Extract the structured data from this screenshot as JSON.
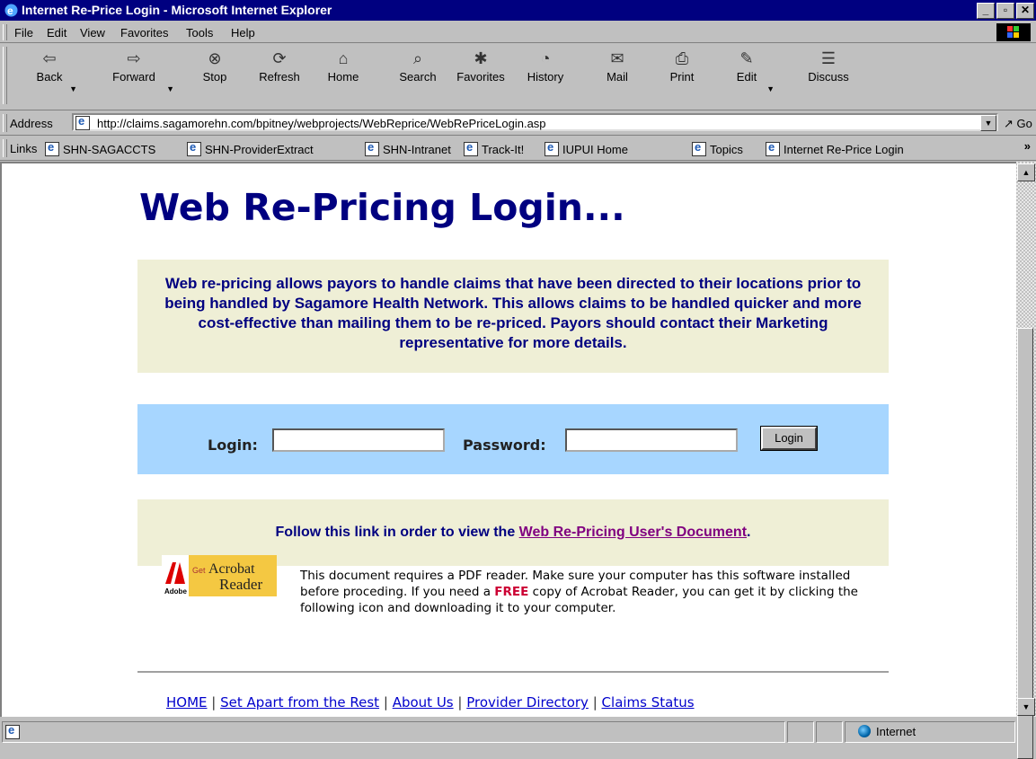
{
  "window": {
    "title": "Internet Re-Price Login - Microsoft Internet Explorer"
  },
  "menu": {
    "items": [
      "File",
      "Edit",
      "View",
      "Favorites",
      "Tools",
      "Help"
    ]
  },
  "toolbar": {
    "buttons": [
      {
        "label": "Back",
        "icon": "back-arrow-icon"
      },
      {
        "label": "Forward",
        "icon": "forward-arrow-icon"
      },
      {
        "label": "Stop",
        "icon": "stop-icon"
      },
      {
        "label": "Refresh",
        "icon": "refresh-icon"
      },
      {
        "label": "Home",
        "icon": "home-icon"
      },
      {
        "label": "Search",
        "icon": "search-icon"
      },
      {
        "label": "Favorites",
        "icon": "favorites-icon"
      },
      {
        "label": "History",
        "icon": "history-icon"
      },
      {
        "label": "Mail",
        "icon": "mail-icon"
      },
      {
        "label": "Print",
        "icon": "print-icon"
      },
      {
        "label": "Edit",
        "icon": "edit-icon"
      },
      {
        "label": "Discuss",
        "icon": "discuss-icon"
      }
    ]
  },
  "address": {
    "label": "Address",
    "url": "http://claims.sagamorehn.com/bpitney/webprojects/WebReprice/WebRePriceLogin.asp",
    "go": "Go"
  },
  "links": {
    "label": "Links",
    "items": [
      "SHN-SAGACCTS",
      "SHN-ProviderExtract",
      "SHN-Intranet",
      "Track-It!",
      "IUPUI Home",
      "Topics",
      "Internet Re-Price Login"
    ]
  },
  "page": {
    "heading": "Web Re-Pricing Login...",
    "description": "Web re-pricing allows payors to handle claims that have been directed to their locations prior to being handled by Sagamore Health Network. This allows claims to be handled quicker and more cost-effective than mailing them to be re-priced. Payors should contact their Marketing representative for more details.",
    "login": {
      "login_label": "Login:",
      "password_label": "Password:",
      "login_value": "",
      "password_value": "",
      "button": "Login"
    },
    "follow": {
      "prefix": "Follow this link in order to view the ",
      "link": "Web Re-Pricing User's Document",
      "suffix": "."
    },
    "acrobat": {
      "get": "Get",
      "product": "Acrobat",
      "product2": "Reader",
      "brand": "Adobe"
    },
    "pdf_note": {
      "part1": "This document requires a PDF reader. Make sure your computer has this software installed before proceding. If you need a ",
      "free": "FREE",
      "part2": " copy of Acrobat Reader, you can get it by clicking the following icon and downloading it to your computer."
    },
    "footer_links": [
      "HOME",
      "Set Apart from the Rest",
      "About Us",
      "Provider Directory",
      "Claims Status"
    ],
    "footer_sep": "|"
  },
  "status": {
    "zone": "Internet"
  }
}
